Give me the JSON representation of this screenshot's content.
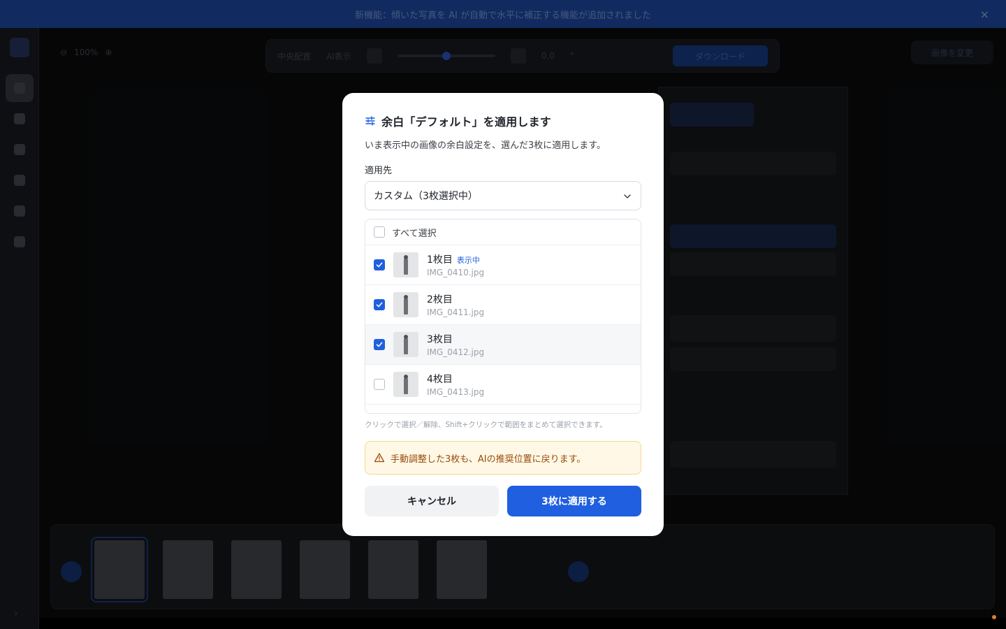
{
  "banner": {
    "text": "新機能：傾いた写真を AI が自動で水平に補正する機能が追加されました",
    "close": "×"
  },
  "canvas": {
    "zoom": "100%"
  },
  "toolbar": {
    "center": "中央配置",
    "guide": "AI表示",
    "angle": "0.0",
    "angle_unit": "°",
    "download": "ダウンロード"
  },
  "topright": {
    "label": "画像を変更"
  },
  "dialog": {
    "title": "余白「デフォルト」を適用します",
    "subtitle": "いま表示中の画像の余白設定を、選んだ3枚に適用します。",
    "target_label": "適用先",
    "select_value": "カスタム（3枚選択中）",
    "select_all": "すべて選択",
    "items": [
      {
        "name": "1枚目",
        "file": "IMG_0410.jpg",
        "checked": true,
        "badge": "表示中"
      },
      {
        "name": "2枚目",
        "file": "IMG_0411.jpg",
        "checked": true,
        "badge": ""
      },
      {
        "name": "3枚目",
        "file": "IMG_0412.jpg",
        "checked": true,
        "badge": ""
      },
      {
        "name": "4枚目",
        "file": "IMG_0413.jpg",
        "checked": false,
        "badge": ""
      }
    ],
    "hint": "クリックで選択／解除、Shift+クリックで範囲をまとめて選択できます。",
    "warning": "手動調整した3枚も、AIの推奨位置に戻ります。",
    "cancel_label": "キャンセル",
    "apply_label": "3枚に適用する"
  },
  "colors": {
    "accent": "#1f5fe0",
    "warning_bg": "#fff8e6",
    "warning_text": "#9a4b0c"
  }
}
